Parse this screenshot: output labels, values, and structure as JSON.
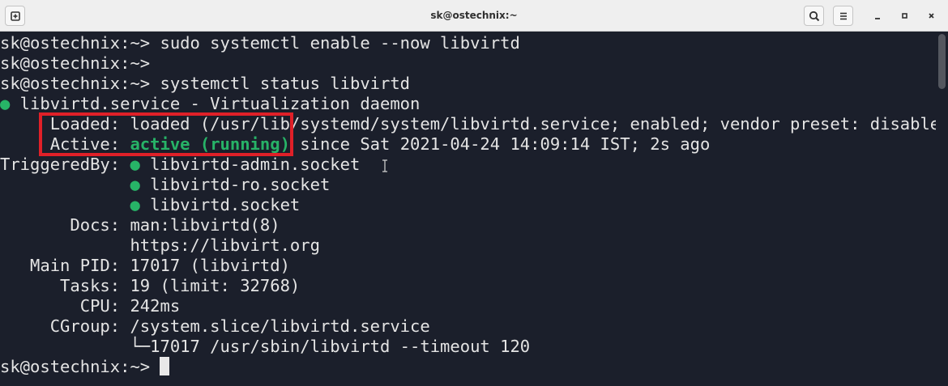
{
  "window": {
    "title": "sk@ostechnix:~"
  },
  "titlebar": {
    "new_tab_icon": "new-tab-icon",
    "search_icon": "search-icon",
    "menu_icon": "hamburger-menu-icon",
    "minimize_icon": "minimize-icon",
    "maximize_icon": "maximize-icon",
    "close_icon": "close-icon"
  },
  "terminal": {
    "colors": {
      "background": "#1b1f2b",
      "foreground": "#e4e4e4",
      "green": "#27b367",
      "highlight_border": "#e02028"
    },
    "lines": {
      "l1": "sk@ostechnix:~> sudo systemctl enable --now libvirtd",
      "l2": "sk@ostechnix:~>",
      "l3": "sk@ostechnix:~> systemctl status libvirtd",
      "l4_bullet": "●",
      "l4_text": " libvirtd.service - Virtualization daemon",
      "l5": "     Loaded: loaded (/usr/lib/systemd/system/libvirtd.service; enabled; vendor preset: disabled)",
      "l6_label": "     Active: ",
      "l6_status": "active (running)",
      "l6_rest": " since Sat 2021-04-24 14:09:14 IST; 2s ago",
      "l7_label": "TriggeredBy: ",
      "l7_bullet": "●",
      "l7_text": " libvirtd-admin.socket",
      "l8_indent": "             ",
      "l8_bullet": "●",
      "l8_text": " libvirtd-ro.socket",
      "l9_indent": "             ",
      "l9_bullet": "●",
      "l9_text": " libvirtd.socket",
      "l10": "       Docs: man:libvirtd(8)",
      "l11": "             https://libvirt.org",
      "l12": "   Main PID: 17017 (libvirtd)",
      "l13": "      Tasks: 19 (limit: 32768)",
      "l14": "        CPU: 242ms",
      "l15": "     CGroup: /system.slice/libvirtd.service",
      "l16": "             └─17017 /usr/sbin/libvirtd --timeout 120",
      "l17_prompt": "sk@ostechnix:~> "
    }
  }
}
